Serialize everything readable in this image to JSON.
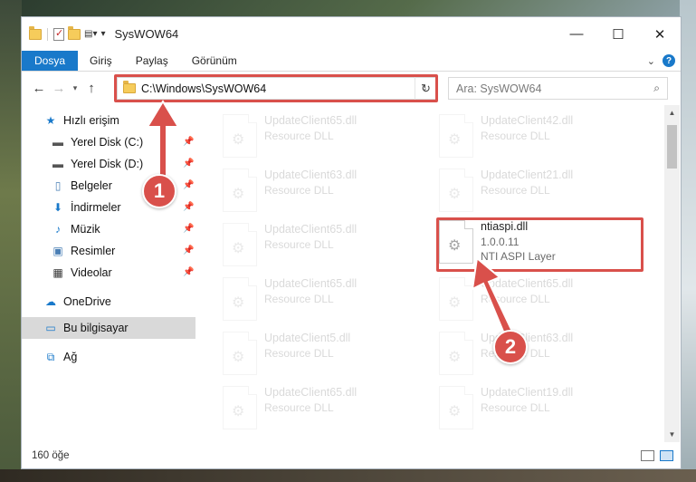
{
  "window": {
    "title": "SysWOW64",
    "controls": {
      "minimize": "—",
      "maximize": "☐",
      "close": "✕"
    }
  },
  "ribbon": {
    "tabs": [
      {
        "label": "Dosya",
        "active": true
      },
      {
        "label": "Giriş"
      },
      {
        "label": "Paylaş"
      },
      {
        "label": "Görünüm"
      }
    ],
    "help": "?"
  },
  "address": {
    "path": "C:\\Windows\\SysWOW64",
    "search_placeholder": "Ara: SysWOW64"
  },
  "nav": {
    "items": [
      {
        "label": "Hızlı erişim",
        "icon": "star-icon"
      },
      {
        "label": "Yerel Disk (C:)",
        "icon": "drive-icon",
        "pinned": true
      },
      {
        "label": "Yerel Disk (D:)",
        "icon": "drive-icon",
        "pinned": true
      },
      {
        "label": "Belgeler",
        "icon": "documents-icon",
        "pinned": true
      },
      {
        "label": "İndirmeler",
        "icon": "download-icon",
        "pinned": true
      },
      {
        "label": "Müzik",
        "icon": "music-icon",
        "pinned": true
      },
      {
        "label": "Resimler",
        "icon": "pictures-icon",
        "pinned": true
      },
      {
        "label": "Videolar",
        "icon": "videos-icon",
        "pinned": true
      },
      {
        "label": "OneDrive",
        "icon": "cloud-icon"
      },
      {
        "label": "Bu bilgisayar",
        "icon": "computer-icon",
        "selected": true
      },
      {
        "label": "Ağ",
        "icon": "network-icon"
      }
    ]
  },
  "files": [
    {
      "name": "UpdateClient65.dll",
      "desc": "Resource DLL"
    },
    {
      "name": "UpdateClient42.dll",
      "desc": "Resource DLL"
    },
    {
      "name": "UpdateClient63.dll",
      "desc": "Resource DLL"
    },
    {
      "name": "UpdateClient21.dll",
      "desc": "Resource DLL"
    },
    {
      "name": "UpdateClient65.dll",
      "desc": "Resource DLL"
    },
    {
      "name": "ntiaspi.dll",
      "version": "1.0.0.11",
      "desc": "NTI ASPI Layer",
      "highlighted": true
    },
    {
      "name": "UpdateClient65.dll",
      "desc": "Resource DLL"
    },
    {
      "name": "UpdateClient65.dll",
      "desc": "Resource DLL"
    },
    {
      "name": "UpdateClient5.dll",
      "desc": "Resource DLL"
    },
    {
      "name": "UpdateClient63.dll",
      "desc": "Resource DLL"
    },
    {
      "name": "UpdateClient65.dll",
      "desc": "Resource DLL"
    },
    {
      "name": "UpdateClient19.dll",
      "desc": "Resource DLL"
    }
  ],
  "status": {
    "count": "160 öğe"
  },
  "annotations": {
    "badge1": "1",
    "badge2": "2",
    "color": "#d9504b"
  }
}
